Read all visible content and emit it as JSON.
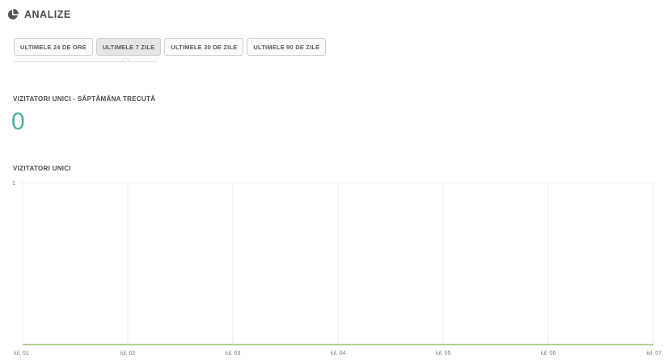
{
  "header": {
    "title": "ANALIZE",
    "icon": "pie-chart-icon"
  },
  "tabs": [
    {
      "label": "ULTIMELE 24 DE ORE",
      "active": false
    },
    {
      "label": "ULTIMELE 7 ZILE",
      "active": true
    },
    {
      "label": "ULTIMELE 30 DE ZILE",
      "active": false
    },
    {
      "label": "ULTIMELE 90 DE ZILE",
      "active": false
    }
  ],
  "stat": {
    "label": "VIZITATORI UNICI - SĂPTĂMÂNA TRECUTĂ",
    "value": "0"
  },
  "colors": {
    "accent": "#4fb09a",
    "line": "#a8c97a",
    "grid": "#ececec"
  },
  "chart_data": {
    "type": "line",
    "title": "VIZITATORI UNICI",
    "xlabel": "",
    "ylabel": "",
    "categories": [
      "iul. 01",
      "iul. 02",
      "iul. 03",
      "iul. 04",
      "iul. 05",
      "iul. 06",
      "iul. 07"
    ],
    "series": [
      {
        "values": [
          0,
          0,
          0,
          0,
          0,
          0,
          0
        ]
      }
    ],
    "ylim": [
      0,
      1
    ],
    "yticks": [
      "1"
    ],
    "grid": true
  }
}
